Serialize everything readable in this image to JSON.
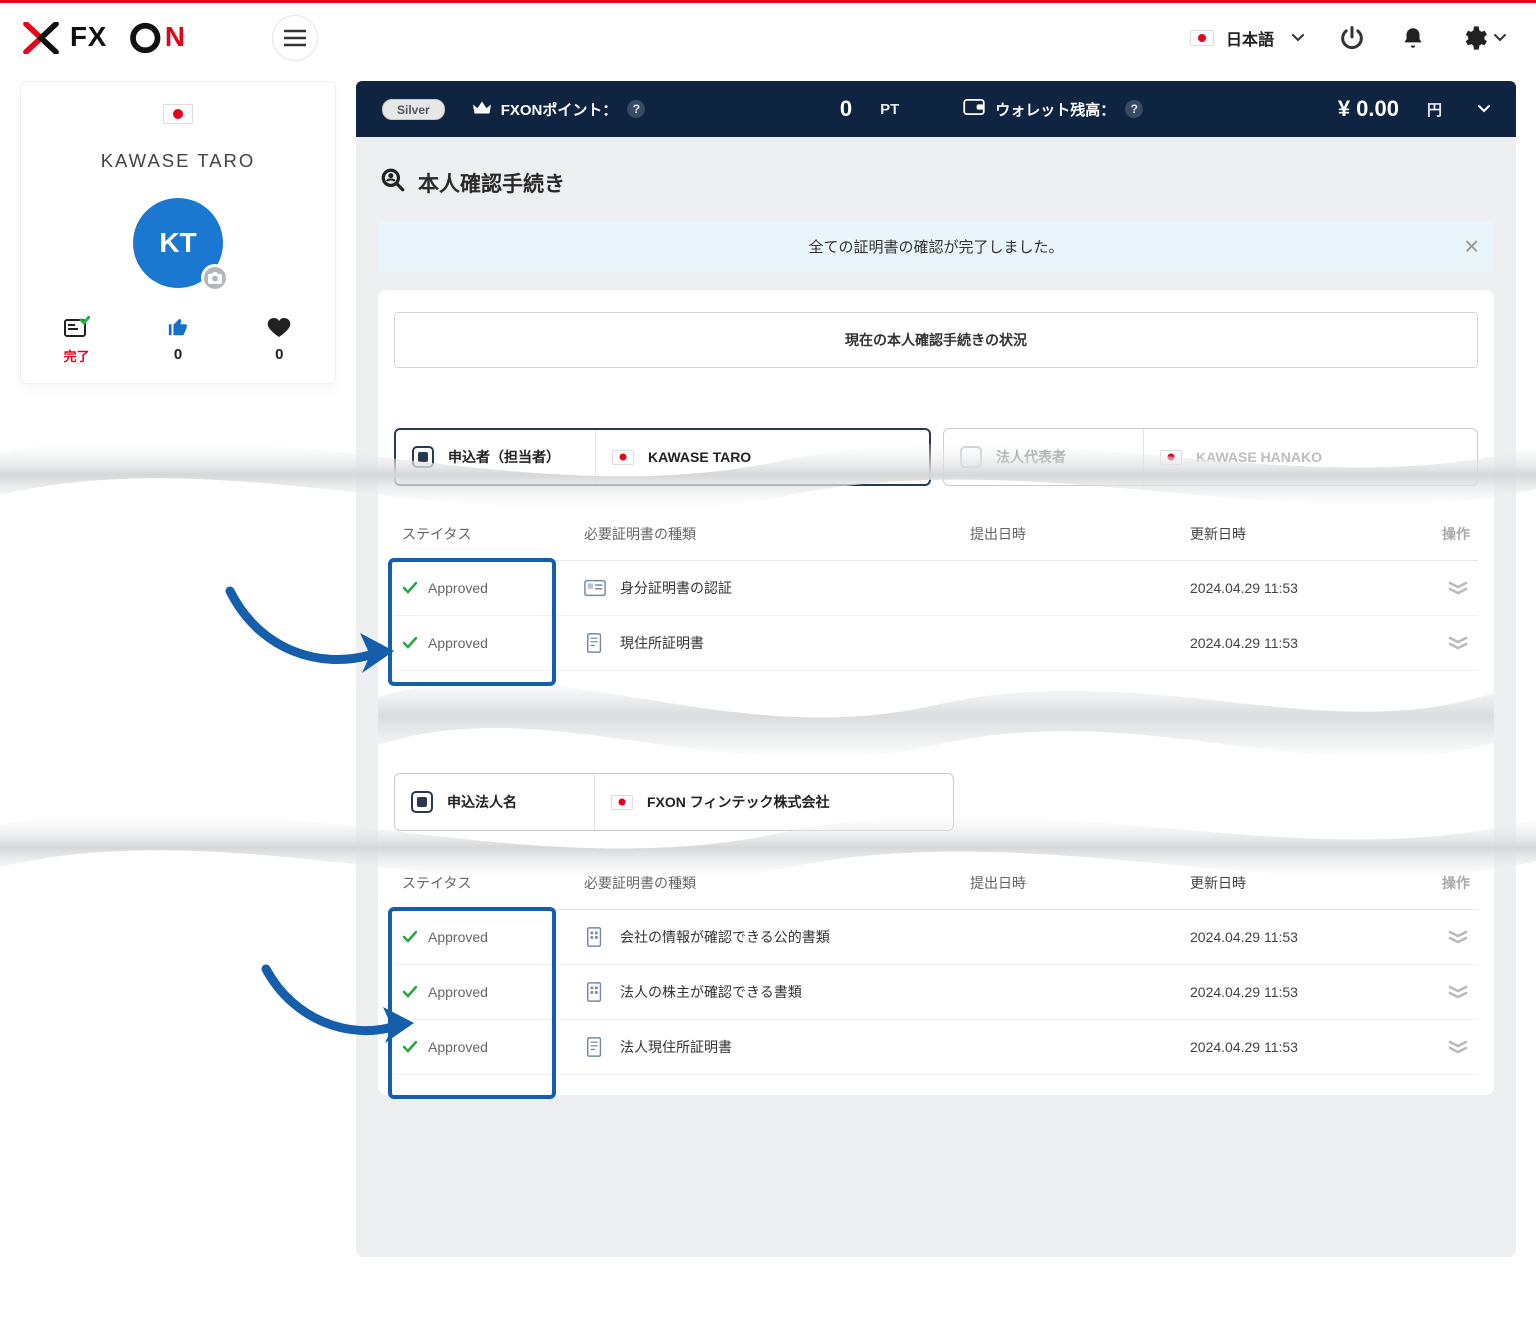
{
  "header": {
    "language": "日本語"
  },
  "statusbar": {
    "tier": "Silver",
    "points_label": "FXONポイント：",
    "points_value": "0",
    "points_unit": "PT",
    "wallet_label": "ウォレット残高：",
    "wallet_value": "¥ 0.00",
    "wallet_unit": "円"
  },
  "sidebar": {
    "name": "KAWASE TARO",
    "initials": "KT",
    "stat_done": "完了",
    "stat_like": "0",
    "stat_fav": "0"
  },
  "page": {
    "title": "本人確認手続き"
  },
  "notice": {
    "message": "全ての証明書の確認が完了しました。"
  },
  "section": {
    "header": "現在の本人確認手続きの状況"
  },
  "tabs": {
    "applicant_label": "申込者（担当者）",
    "applicant_name": "KAWASE TARO",
    "rep_label": "法人代表者",
    "rep_name": "KAWASE HANAKO"
  },
  "table_headers": {
    "status": "ステイタス",
    "type": "必要証明書の種類",
    "submitted": "提出日時",
    "updated": "更新日時",
    "op": "操作"
  },
  "table1": {
    "rows": [
      {
        "status": "Approved",
        "type": "身分証明書の認証",
        "updated": "2024.04.29 11:53"
      },
      {
        "status": "Approved",
        "type": "現住所証明書",
        "updated": "2024.04.29 11:53"
      }
    ]
  },
  "corp": {
    "label": "申込法人名",
    "name": "FXON フィンテック株式会社"
  },
  "table2": {
    "rows": [
      {
        "status": "Approved",
        "type": "会社の情報が確認できる公的書類",
        "updated": "2024.04.29 11:53"
      },
      {
        "status": "Approved",
        "type": "法人の株主が確認できる書類",
        "updated": "2024.04.29 11:53"
      },
      {
        "status": "Approved",
        "type": "法人現住所証明書",
        "updated": "2024.04.29 11:53"
      }
    ]
  }
}
